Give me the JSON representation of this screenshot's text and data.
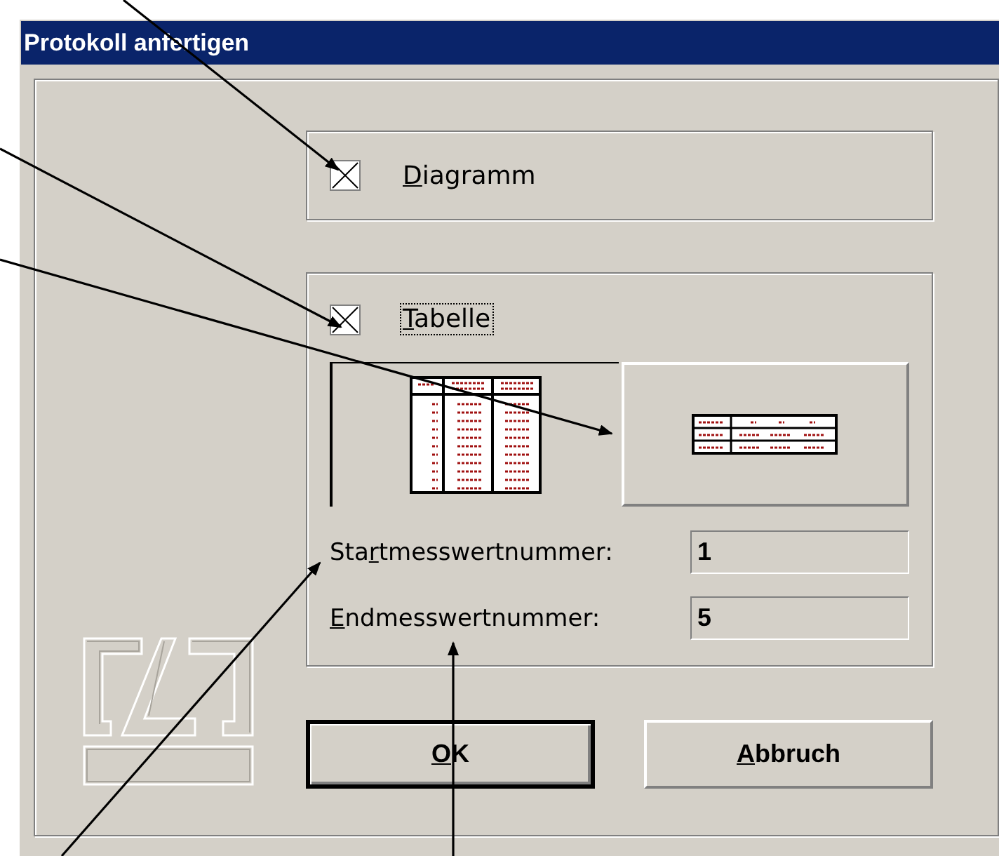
{
  "window": {
    "title": "Protokoll anfertigen"
  },
  "diagram_option": {
    "label": {
      "key": "D",
      "after": "iagramm"
    },
    "checked": true
  },
  "table_option": {
    "label": {
      "key": "T",
      "after": "abelle"
    },
    "checked": true,
    "focused": true
  },
  "layouts": [
    {
      "kind": "vertical",
      "selected": true
    },
    {
      "kind": "horizontal",
      "selected": false
    }
  ],
  "fields": [
    {
      "label": {
        "before": "Sta",
        "key": "r",
        "after": "tmesswertnummer:"
      },
      "value": "1"
    },
    {
      "label": {
        "key": "E",
        "after": "ndmesswertnummer:"
      },
      "value": "5"
    }
  ],
  "buttons": [
    {
      "label": {
        "key": "O",
        "after": "K"
      },
      "default": true
    },
    {
      "label": {
        "key": "A",
        "after": "bbruch"
      },
      "default": false
    }
  ]
}
